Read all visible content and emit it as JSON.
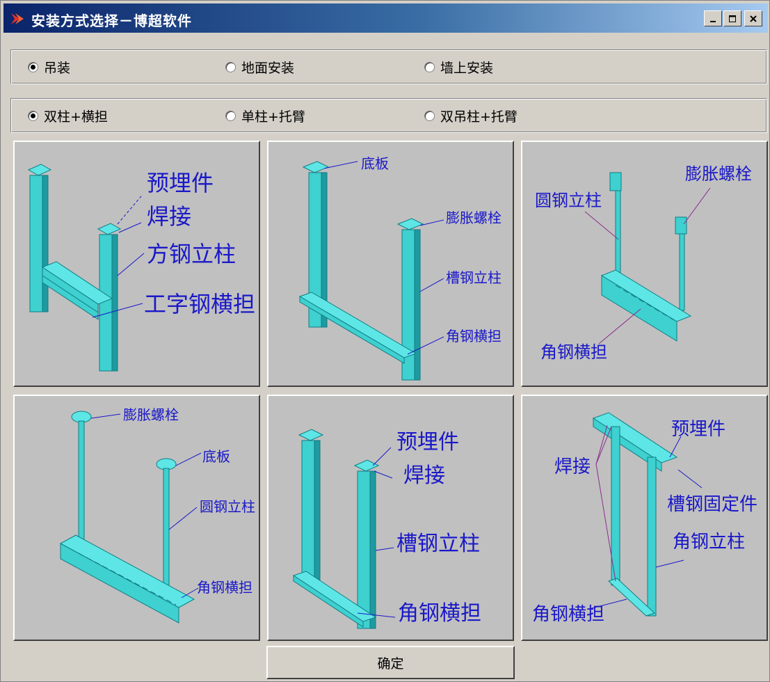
{
  "window": {
    "title": "安装方式选择－博超软件",
    "controls": [
      "minimize-icon",
      "maximize-icon",
      "close-icon"
    ]
  },
  "install_mode": {
    "options": [
      {
        "label": "吊装",
        "checked": true
      },
      {
        "label": "地面安装",
        "checked": false
      },
      {
        "label": "墙上安装",
        "checked": false
      }
    ]
  },
  "structure_type": {
    "options": [
      {
        "label": "双柱+横担",
        "checked": true
      },
      {
        "label": "单柱+托臂",
        "checked": false
      },
      {
        "label": "双吊柱+托臂",
        "checked": false
      }
    ]
  },
  "tiles": [
    {
      "labels": [
        "预埋件",
        "焊接",
        "方钢立柱",
        "工字钢横担"
      ]
    },
    {
      "labels": [
        "底板",
        "膨胀螺栓",
        "槽钢立柱",
        "角钢横担"
      ]
    },
    {
      "labels": [
        "膨胀螺栓",
        "圆钢立柱",
        "角钢横担"
      ]
    },
    {
      "labels": [
        "膨胀螺栓",
        "底板",
        "圆钢立柱",
        "角钢横担"
      ]
    },
    {
      "labels": [
        "预埋件",
        "焊接",
        "槽钢立柱",
        "角钢横担"
      ]
    },
    {
      "labels": [
        "预埋件",
        "焊接",
        "槽钢固定件",
        "角钢立柱",
        "角钢横担"
      ]
    }
  ],
  "ok_button": {
    "label": "确定"
  },
  "colors": {
    "steel": "#3fd0d0",
    "steel_dark": "#1e9aa0",
    "callout": "#1a18c8",
    "titlebar": "#0a246a"
  }
}
